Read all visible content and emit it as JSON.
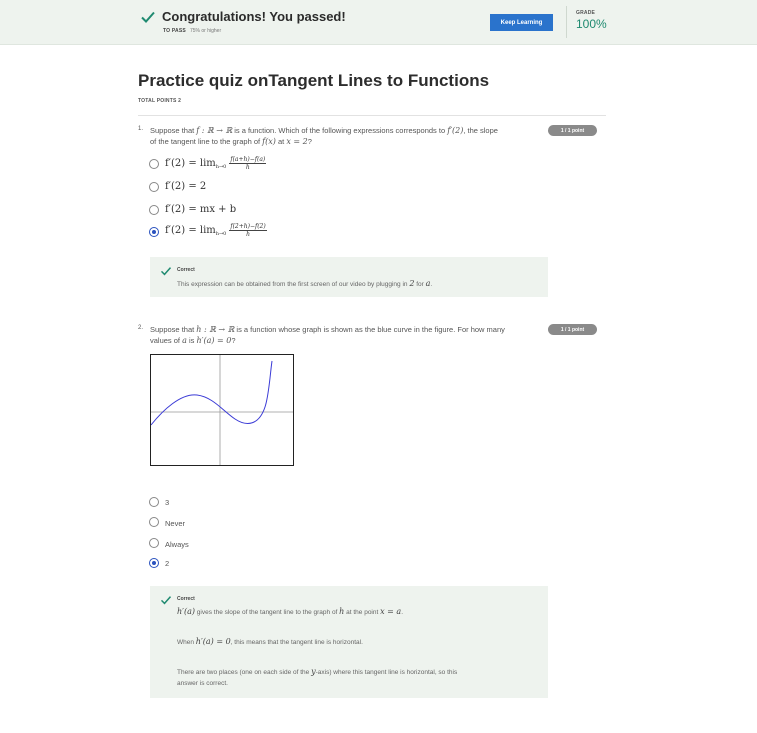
{
  "banner": {
    "title": "Congratulations! You passed!",
    "to_pass_label": "TO PASS",
    "to_pass_value": "75% or higher",
    "keep_learning": "Keep Learning",
    "grade_label": "GRADE",
    "grade_value": "100%"
  },
  "quiz": {
    "title": "Practice quiz onTangent Lines to Functions",
    "total_points": "TOTAL POINTS 2"
  },
  "q1": {
    "number": "1.",
    "text_a": "Suppose that ",
    "text_f": "f : ℝ → ℝ",
    "text_b": " is a function. Which of the following expressions corresponds to ",
    "text_fp2": "f′(2)",
    "text_c": ", the slope",
    "text_line2": "of the tangent line to the graph of ",
    "text_fx": "f(x)",
    "text_at": " at ",
    "text_x2": "x = 2",
    "text_q": "?",
    "points": "1 / 1 point",
    "options": [
      {
        "lhs": "f′(2) = lim",
        "sub": "h→0",
        "num": "f(a+h)−f(a)",
        "den": "h",
        "selected": false
      },
      {
        "text": "f′(2) = 2",
        "selected": false
      },
      {
        "text": "f′(2) = mx + b",
        "selected": false
      },
      {
        "lhs": "f′(2) = lim",
        "sub": "h→0",
        "num": "f(2+h)−f(2)",
        "den": "h",
        "selected": true
      }
    ],
    "feedback_label": "Correct",
    "feedback_text_a": "This expression can be obtained from the first screen of our video by plugging in ",
    "feedback_math": "2",
    "feedback_text_b": " for ",
    "feedback_var": "a",
    "feedback_text_c": "."
  },
  "q2": {
    "number": "2.",
    "text_a": "Suppose that ",
    "text_h": "h : ℝ → ℝ",
    "text_b": " is a function whose graph is shown as the blue curve in the figure. For how many",
    "text_line2": "values of ",
    "text_a_var": "a",
    "text_is": " is ",
    "text_ha": "h′(a) = 0",
    "text_q": "?",
    "points": "1 / 1 point",
    "options": [
      {
        "text": "3",
        "selected": false
      },
      {
        "text": "Never",
        "selected": false
      },
      {
        "text": "Always",
        "selected": false
      },
      {
        "text": "2",
        "selected": true
      }
    ],
    "feedback_label": "Correct",
    "fb1_math": "h′(a)",
    "fb1_text": " gives the slope of the tangent line to the graph of ",
    "fb1_h": "h",
    "fb1_text2": " at the point ",
    "fb1_xa": "x = a",
    "fb1_end": ".",
    "fb2_text": "When ",
    "fb2_math": "h′(a) = 0",
    "fb2_text2": ", this means that the tangent line is horizontal.",
    "fb3_text": "There are two places (one on each side of the ",
    "fb3_y": "y",
    "fb3_text2": "-axis) where this tangent line is horizontal, so this",
    "fb3_line2": "answer is correct."
  },
  "colors": {
    "accent_blue": "#2a73cc",
    "check_green": "#1f8a70",
    "curve_blue": "#3b3bd6"
  }
}
